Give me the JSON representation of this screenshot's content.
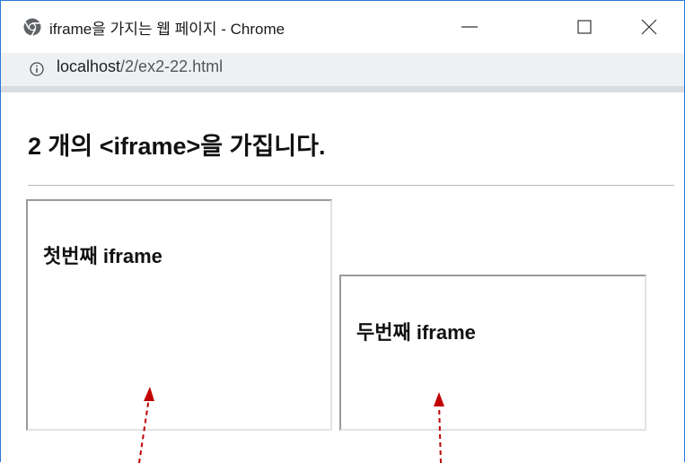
{
  "window": {
    "title": "iframe을 가지는 웹 페이지 - Chrome",
    "controls": {
      "minimize": "minimize",
      "maximize": "maximize",
      "close": "close"
    }
  },
  "address_bar": {
    "host": "localhost",
    "path": "/2/ex2-22.html",
    "icon": "info-icon"
  },
  "page": {
    "heading": "2 개의 <iframe>을 가집니다.",
    "iframes": [
      {
        "heading": "첫번째 iframe"
      },
      {
        "heading": "두번째 iframe"
      }
    ]
  },
  "annotations": {
    "arrow_color": "#c00000"
  },
  "colors": {
    "window_border": "#2b79d8",
    "address_bg": "#eef1f4"
  }
}
